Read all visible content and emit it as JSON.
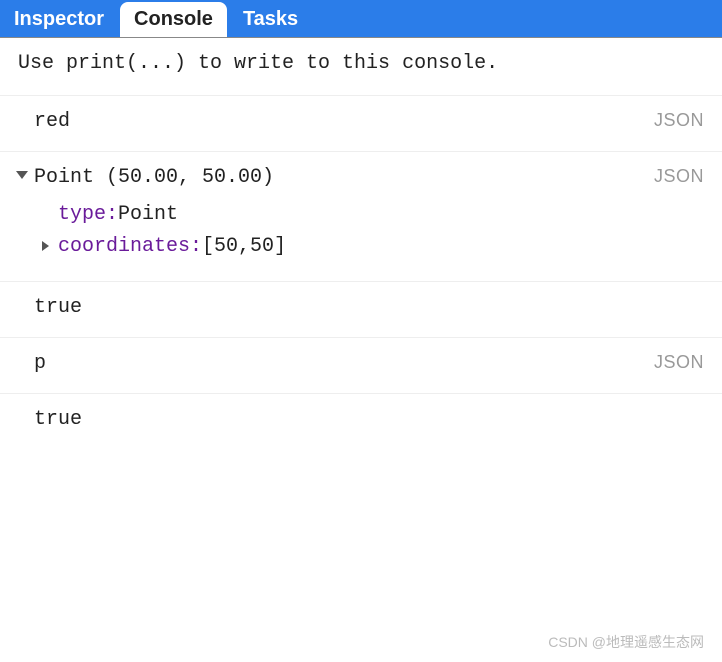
{
  "tabs": [
    {
      "label": "Inspector",
      "active": false
    },
    {
      "label": "Console",
      "active": true
    },
    {
      "label": "Tasks",
      "active": false
    }
  ],
  "hint_text": "Use print(...) to write to this console.",
  "json_label": "JSON",
  "entries": [
    {
      "value": "red",
      "has_json": true,
      "expandable": false
    },
    {
      "value": "Point (50.00, 50.00)",
      "has_json": true,
      "expandable": true,
      "expanded": true,
      "details": [
        {
          "key": "type",
          "val": "Point",
          "expandable": false
        },
        {
          "key": "coordinates",
          "val": "[50,50]",
          "expandable": true
        }
      ]
    },
    {
      "value": "true",
      "has_json": false,
      "expandable": false
    },
    {
      "value": "p",
      "has_json": true,
      "expandable": false
    },
    {
      "value": "true",
      "has_json": false,
      "expandable": false
    }
  ],
  "watermark": "CSDN @地理遥感生态网"
}
